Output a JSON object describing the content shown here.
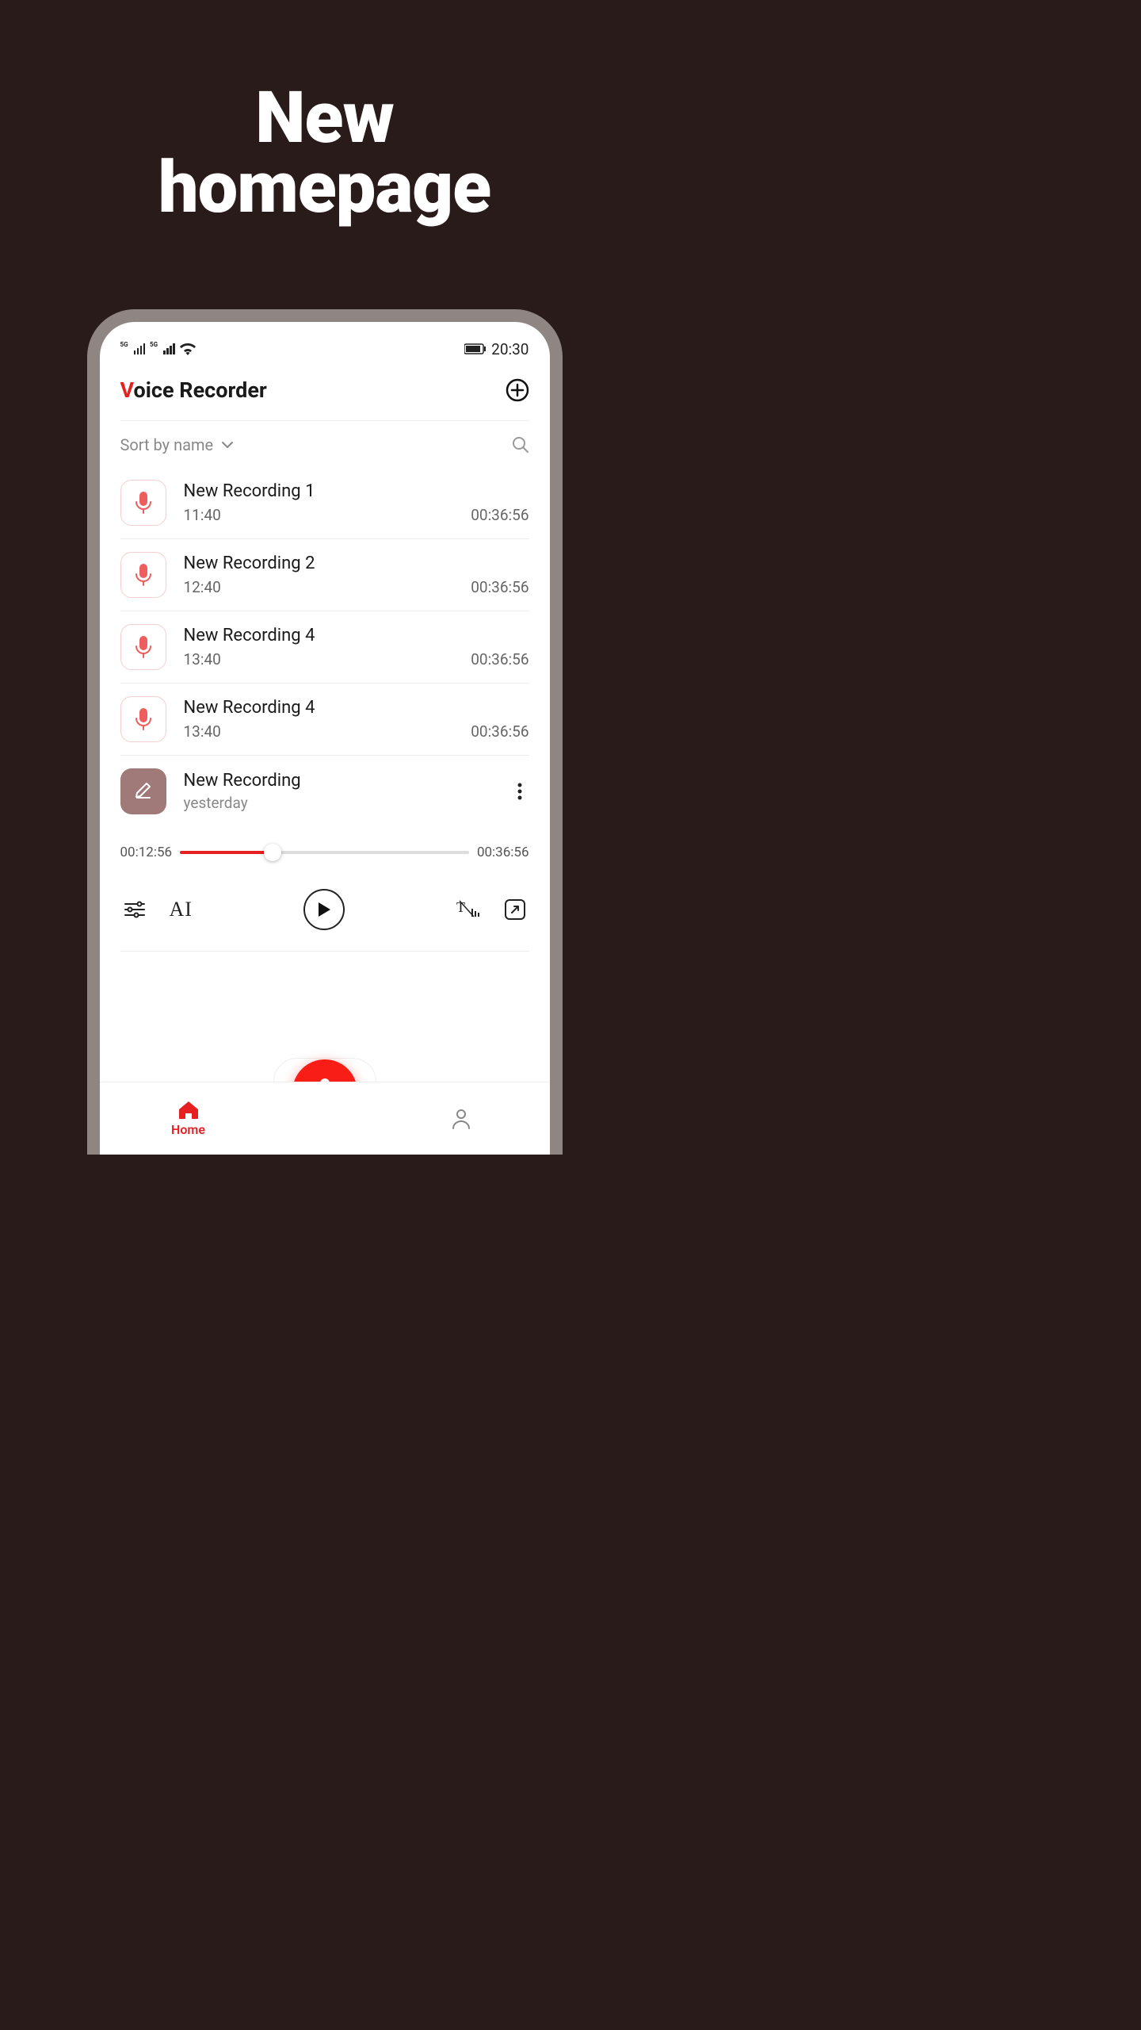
{
  "headline_line1": "New",
  "headline_line2": "homepage",
  "status": {
    "sig1_label": "5G",
    "sig2_label": "5G",
    "time": "20:30"
  },
  "app": {
    "title_first_letter": "V",
    "title_rest": "oice Recorder"
  },
  "sort": {
    "label": "Sort by name"
  },
  "recordings": [
    {
      "title": "New Recording 1",
      "time": "11:40",
      "duration": "00:36:56"
    },
    {
      "title": "New Recording 2",
      "time": "12:40",
      "duration": "00:36:56"
    },
    {
      "title": "New Recording 4",
      "time": "13:40",
      "duration": "00:36:56"
    },
    {
      "title": "New Recording 4",
      "time": "13:40",
      "duration": "00:36:56"
    }
  ],
  "expanded": {
    "title": "New Recording",
    "subtitle": "yesterday",
    "elapsed": "00:12:56",
    "total": "00:36:56",
    "progress_pct": 32
  },
  "controls": {
    "ai_label": "AI"
  },
  "nav": {
    "home_label": "Home"
  }
}
